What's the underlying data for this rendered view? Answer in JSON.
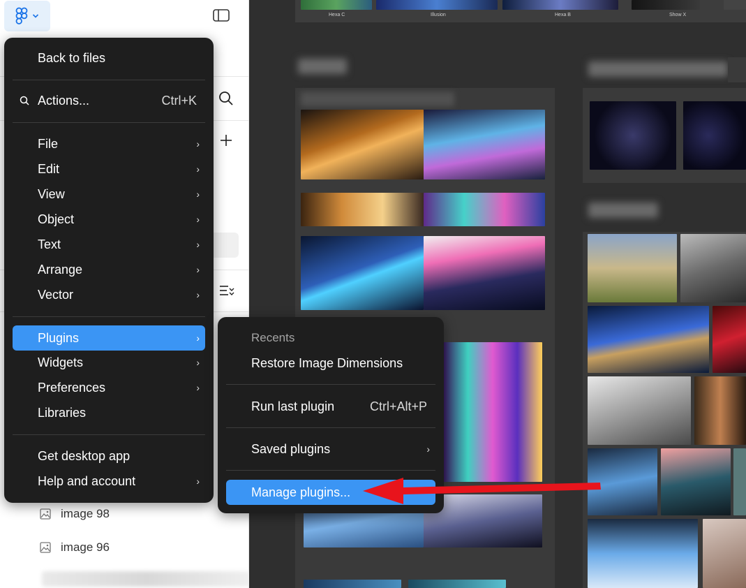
{
  "main_menu": {
    "back_to_files": "Back to files",
    "actions": {
      "label": "Actions...",
      "shortcut": "Ctrl+K"
    },
    "file": "File",
    "edit": "Edit",
    "view": "View",
    "object": "Object",
    "text": "Text",
    "arrange": "Arrange",
    "vector": "Vector",
    "plugins": "Plugins",
    "widgets": "Widgets",
    "preferences": "Preferences",
    "libraries": "Libraries",
    "get_desktop_app": "Get desktop app",
    "help_and_account": "Help and account"
  },
  "plugins_submenu": {
    "recents_header": "Recents",
    "restore_image_dimensions": "Restore Image Dimensions",
    "run_last_plugin": {
      "label": "Run last plugin",
      "shortcut": "Ctrl+Alt+P"
    },
    "saved_plugins": "Saved plugins",
    "manage_plugins": "Manage plugins..."
  },
  "layers": [
    {
      "name": "image 98"
    },
    {
      "name": "image 96"
    }
  ],
  "canvas_labels": [
    "Hexa C",
    "Illusion",
    "Hexa B",
    "Show X"
  ],
  "colors": {
    "accent": "#3b95f4",
    "menu_bg": "#1e1e1e",
    "canvas_bg": "#2f2f2f",
    "annotation_arrow": "#e8141c"
  }
}
